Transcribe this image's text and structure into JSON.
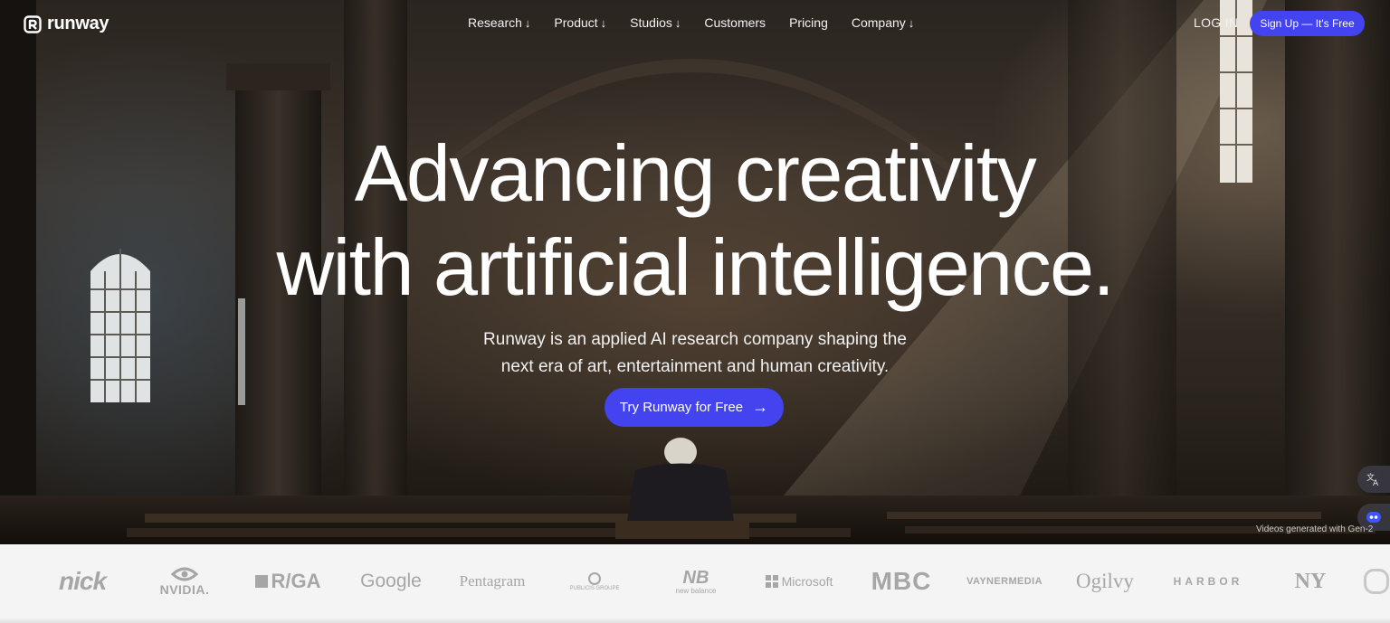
{
  "nav": {
    "logo_text": "runway",
    "menu": [
      {
        "label": "Research",
        "arrow": "↓"
      },
      {
        "label": "Product",
        "arrow": "↓"
      },
      {
        "label": "Studios",
        "arrow": "↓"
      },
      {
        "label": "Customers",
        "arrow": ""
      },
      {
        "label": "Pricing",
        "arrow": ""
      },
      {
        "label": "Company",
        "arrow": "↓"
      }
    ],
    "login_label": "LOG IN",
    "signup_label": "Sign Up — It's Free"
  },
  "hero": {
    "headline_line1": "Advancing creativity",
    "headline_line2": "with artificial intelligence.",
    "subtext_line1": "Runway is an applied AI research company shaping the",
    "subtext_line2": "next era of art, entertainment and human creativity.",
    "cta_label": "Try Runway for Free",
    "cta_arrow": "→",
    "caption": "Videos generated with Gen-2"
  },
  "logos": [
    "nick",
    "NVIDIA.",
    "R/GA",
    "Google",
    "Pentagram",
    "PUBLICIS GROUPE",
    "new balance",
    "Microsoft",
    "MBC",
    "VAYNERMEDIA",
    "Ogilvy",
    "HARBOR",
    "NY"
  ],
  "colors": {
    "accent": "#4343f0",
    "strip_bg": "#f4f4f4",
    "logo_gray": "#a6a6a6"
  },
  "icons": {
    "translate": "translate-icon",
    "chat": "chat-bot-icon",
    "logo": "runway-logo-icon"
  }
}
